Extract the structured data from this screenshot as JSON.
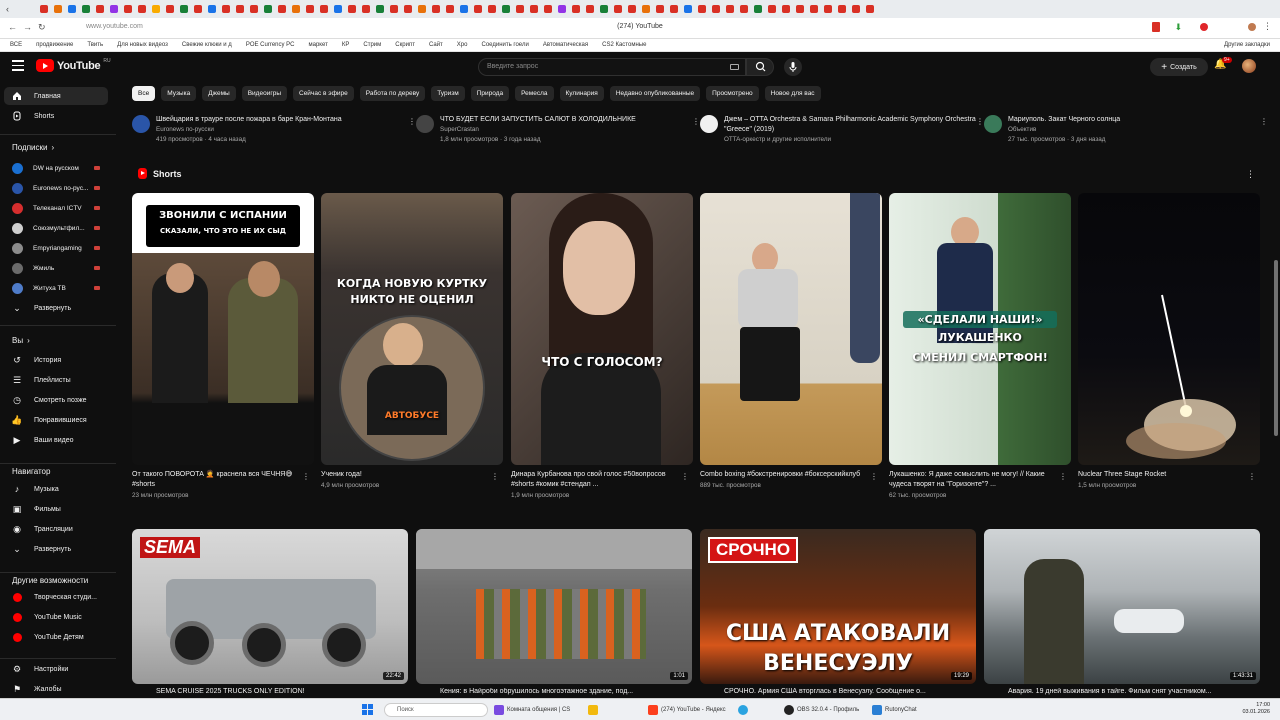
{
  "browser": {
    "tab_title": "(274) YouTube",
    "url": "www.youtube.com",
    "bookmarks": [
      "ВСЕ",
      "продвижение",
      "Твить",
      "Для новых видеоз",
      "Свежие клюки и д",
      "POE Currency PC",
      "маркет",
      "КР",
      "Стрим",
      "Скрипт",
      "Сайт",
      "Хро",
      "Соединить гоели",
      "Автоматическая",
      "CS2 Кастомные"
    ],
    "bookmarks_right": "Другие закладки",
    "tab_colors": [
      "#d93025",
      "#e8710a",
      "#1a73e8",
      "#188038",
      "#d93025",
      "#9334e6",
      "#d93025",
      "#d93025",
      "#f9ab00",
      "#d93025",
      "#188038",
      "#d93025",
      "#1a73e8",
      "#d93025",
      "#d93025",
      "#d93025",
      "#188038",
      "#d93025",
      "#e8710a",
      "#d93025",
      "#d93025",
      "#1a73e8",
      "#d93025",
      "#d93025",
      "#188038",
      "#d93025",
      "#d93025",
      "#e8710a",
      "#d93025",
      "#d93025",
      "#1a73e8",
      "#d93025",
      "#d93025",
      "#188038",
      "#d93025",
      "#d93025",
      "#d93025",
      "#9334e6",
      "#d93025",
      "#d93025",
      "#188038",
      "#d93025",
      "#d93025",
      "#e8710a",
      "#d93025",
      "#d93025",
      "#1a73e8",
      "#d93025",
      "#d93025",
      "#d93025",
      "#d93025",
      "#188038",
      "#d93025",
      "#d93025",
      "#d93025",
      "#d93025",
      "#d93025",
      "#d93025",
      "#d93025",
      "#d93025"
    ]
  },
  "header": {
    "logo_text": "YouTube",
    "logo_region": "RU",
    "search_placeholder": "Введите запрос",
    "create_label": "Создать",
    "notifications_badge": "9+"
  },
  "sidebar": {
    "main": [
      {
        "label": "Главная",
        "icon": "home-icon",
        "active": true
      },
      {
        "label": "Shorts",
        "icon": "shorts-icon",
        "active": false
      }
    ],
    "subscriptions_title": "Подписки",
    "subscriptions": [
      {
        "label": "DW на русском",
        "color": "#1a6fd1"
      },
      {
        "label": "Euronews по-рус...",
        "color": "#2a55a8"
      },
      {
        "label": "Телеканал ICTV",
        "color": "#d62e2e"
      },
      {
        "label": "Союзмультфил...",
        "color": "#cfcfcf"
      },
      {
        "label": "Empyriangaming",
        "color": "#8c8c8c"
      },
      {
        "label": "Жмиль",
        "color": "#6b6b6b"
      },
      {
        "label": "Житуха TB",
        "color": "#4f7cc9"
      }
    ],
    "expand_label": "Развернуть",
    "you_title": "Вы",
    "you_items": [
      {
        "label": "История",
        "icon": "history-icon"
      },
      {
        "label": "Плейлисты",
        "icon": "playlist-icon"
      },
      {
        "label": "Смотреть позже",
        "icon": "clock-icon"
      },
      {
        "label": "Понравившиеся",
        "icon": "like-icon"
      },
      {
        "label": "Ваши видео",
        "icon": "video-icon"
      }
    ],
    "nav_title": "Навигатор",
    "nav_items": [
      {
        "label": "Музыка",
        "icon": "music-icon"
      },
      {
        "label": "Фильмы",
        "icon": "film-icon"
      },
      {
        "label": "Трансляции",
        "icon": "broadcast-icon"
      },
      {
        "label": "Развернуть",
        "icon": "chevron-down-icon"
      }
    ],
    "other_title": "Другие возможности",
    "other_items": [
      {
        "label": "Творческая студи..."
      },
      {
        "label": "YouTube Music"
      },
      {
        "label": "YouTube Детям"
      }
    ],
    "settings_label": "Настройки",
    "complaints_label": "Жалобы"
  },
  "chips": [
    "Все",
    "Музыка",
    "Джемы",
    "Видеоигры",
    "Сейчас в эфире",
    "Работа по дереву",
    "Туризм",
    "Природа",
    "Ремесла",
    "Кулинария",
    "Недавно опубликованные",
    "Просмотрено",
    "Новое для вас"
  ],
  "top_row": [
    {
      "title": "Швейцария в трауре после пожара в баре Кран-Монтана",
      "channel": "Euronews по-русски",
      "meta": "419 просмотров · 4 часа назад"
    },
    {
      "title": "ЧТО БУДЕТ ЕСЛИ ЗАПУСТИТЬ САЛЮТ В ХОЛОДИЛЬНИКЕ",
      "channel": "SuperCrastan",
      "meta": "1,8 млн просмотров · 3 года назад"
    },
    {
      "title": "Джем – OTTA Orchestra & Samara Philharmonic Academic Symphony Orchestra \"Greece\" (2019)",
      "channel": "",
      "meta": "OTTA-оркестр и другие исполнители"
    },
    {
      "title": "Мариуполь. Закат Черного солнца",
      "channel": "Объектив",
      "meta": "27 тыс. просмотров · 3 дня назад"
    }
  ],
  "shorts": {
    "title": "Shorts",
    "items": [
      {
        "title": "От такого ПОВОРОТА 🤦 краснела вся ЧЕЧНЯ😅 #shorts",
        "views": "23 млн просмотров",
        "overlay1": "ЗВОНИЛИ С ИСПАНИИ",
        "overlay2": "СКАЗАЛИ, ЧТО ЭТО НЕ ИХ СЫД"
      },
      {
        "title": "Ученик года!",
        "views": "4,9 млн просмотров",
        "overlay1": "КОГДА НОВУЮ КУРТКУ",
        "overlay2": "НИКТО НЕ ОЦЕНИЛ",
        "overlay3": "АВТОБУСЕ"
      },
      {
        "title": "Динара Курбанова про свой голос #50вопросов #shorts #комик #стендап ...",
        "views": "1,9 млн просмотров",
        "overlay1": "ЧТО С ГОЛОСОМ?"
      },
      {
        "title": "Combo boxing #бокстренировки #боксерскийклуб",
        "views": "889 тыс. просмотров"
      },
      {
        "title": "Лукашенко: Я даже осмыслить не могу! // Какие чудеса творят на \"Горизонте\"? ...",
        "views": "62 тыс. просмотров",
        "overlay1": "«СДЕЛАЛИ НАШИ!»",
        "overlay2": "ЛУКАШЕНКО",
        "overlay3": "СМЕНИЛ СМАРТФОН!"
      },
      {
        "title": "Nuclear Three Stage Rocket",
        "views": "1,5 млн просмотров"
      }
    ]
  },
  "videos": [
    {
      "title": "SEMA CRUISE 2025 TRUCKS ONLY EDITION!",
      "duration": "22:42",
      "badge": "SEMA"
    },
    {
      "title": "Кения: в Найроби обрушилось многоэтажное здание, под...",
      "duration": "1:01"
    },
    {
      "title": "СРОЧНО. Армия США вторглась в Венесуэлу. Сообщение о...",
      "duration": "19:29",
      "overlay1": "СРОЧНО",
      "overlay2": "США АТАКОВАЛИ",
      "overlay3": "ВЕНЕСУЭЛУ"
    },
    {
      "title": "Авария. 19 дней выживания в тайге. Фильм снят участником...",
      "duration": "1:43:31"
    }
  ],
  "taskbar": {
    "search_label": "Поиск",
    "apps": [
      "Комната общения | CS",
      "(274) YouTube - Яндекс",
      "OBS 32.0.4 - Профиль",
      "RutonyChat"
    ],
    "time": "17:00",
    "date": "03.01.2026"
  }
}
